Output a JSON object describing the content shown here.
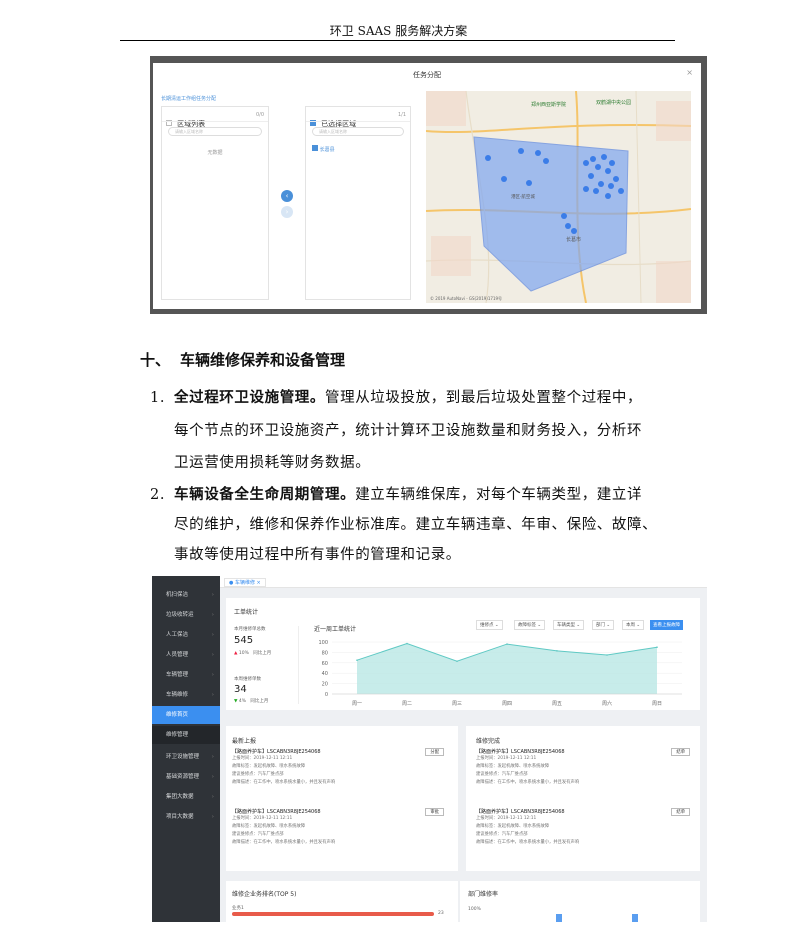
{
  "header": {
    "title": "环卫 SAAS 服务解决方案"
  },
  "modal": {
    "title": "任务分配",
    "close": "×",
    "breadcrumb": "长期清运工作组任务分配",
    "left_panel": {
      "title": "区域列表",
      "count": "0/0",
      "search_placeholder": "请输入区域名称",
      "empty": "无数据"
    },
    "right_panel": {
      "title": "已选择区域",
      "count": "1/1",
      "search_placeholder": "请输入区域名称",
      "item": "长葛县"
    },
    "map": {
      "labels": [
        "郑州西亚斯学院",
        "双鹤湖中央公园",
        "港区·航空城",
        "长葛市"
      ],
      "attribution": "© 2019 AutoNavi - GS(2019)1719号"
    }
  },
  "section10": {
    "number": "十、",
    "title": "车辆维修保养和设备管理",
    "items": [
      {
        "num": "1.",
        "bold": "全过程环卫设施管理。",
        "line1": "管理从垃圾投放，到最后垃圾处置整个过程中，",
        "line2": "每个节点的环卫设施资产，统计计算环卫设施数量和财务投入，分析环",
        "line3": "卫运营使用损耗等财务数据。"
      },
      {
        "num": "2.",
        "bold": "车辆设备全生命周期管理。",
        "line1": "建立车辆维保库，对每个车辆类型，建立详",
        "line2": "尽的维护，维修和保养作业标准库。建立车辆违章、年审、保险、故障、",
        "line3": "事故等使用过程中所有事件的管理和记录。"
      }
    ]
  },
  "dashboard": {
    "sidebar": [
      {
        "label": "机扫保洁"
      },
      {
        "label": "垃圾收转运"
      },
      {
        "label": "人工保洁"
      },
      {
        "label": "人员管理"
      },
      {
        "label": "车辆管理"
      },
      {
        "label": "车辆维修"
      },
      {
        "label": "维修首页"
      },
      {
        "label": "维修管理"
      },
      {
        "label": "环卫设施管理"
      },
      {
        "label": "基础资源管理"
      },
      {
        "label": "集团大数据"
      },
      {
        "label": "项目大数据"
      }
    ],
    "tab": "车辆维修",
    "work_stats": {
      "title": "工单统计",
      "month_label": "本月维修单总数",
      "month_value": "545",
      "month_change": "10%",
      "month_compare": "同比上月",
      "week_label": "本周维修单数",
      "week_value": "34",
      "week_change": "4%",
      "week_compare": "同比上月",
      "chart_title": "近一周工单统计",
      "filters": [
        "维修点",
        "故障标签",
        "车辆类型",
        "部门",
        "本周"
      ],
      "report_button": "查看上报故障"
    },
    "latest": {
      "title": "最新上报",
      "records": [
        {
          "title": "【路面养护车】LSCABN3R8JE254068",
          "button": "分配",
          "time": "上报时间：2019-12-11  12:11",
          "tags": "故障标签：发起机故障、喷水系统故障",
          "site": "建议维修点：汽车厂维点部",
          "desc": "故障描述：在工作中，喷水系统水量小，并且发有声响"
        },
        {
          "title": "【路面养护车】LSCABN3R8JE254068",
          "button": "审批",
          "time": "上报时间：2019-12-11  12:11",
          "tags": "故障标签：发起机故障、喷水系统故障",
          "site": "建议维修点：汽车厂维点部",
          "desc": "故障描述：在工作中，喷水系统水量小，并且发有声响"
        }
      ]
    },
    "done": {
      "title": "维修完成",
      "records": [
        {
          "title": "【路面养护车】LSCABN3R8JE254068",
          "button": "结单",
          "time": "上报时间：2019-12-11  12:11",
          "tags": "故障标签：发起机故障、喷水系统故障",
          "site": "建议维修点：汽车厂维点部",
          "desc": "故障描述：在工作中，喷水系统水量小，并且发有声响"
        },
        {
          "title": "【路面养护车】LSCABN3R8JE254068",
          "button": "结单",
          "time": "上报时间：2019-12-11  12:11",
          "tags": "故障标签：发起机故障、喷水系统故障",
          "site": "建议维修点：汽车厂维点部",
          "desc": "故障描述：在工作中，喷水系统水量小，并且发有声响"
        }
      ]
    },
    "ranking": {
      "title": "维修企业务排名(TOP 5)",
      "first_label": "业务1",
      "first_value": "23"
    },
    "rate": {
      "title": "部门维修率",
      "y_label": "100%"
    }
  },
  "chart_data": {
    "type": "area",
    "title": "近一周工单统计",
    "categories": [
      "周一",
      "周二",
      "周三",
      "周四",
      "周五",
      "周六",
      "周日"
    ],
    "values": [
      65,
      97,
      63,
      96,
      83,
      75,
      90
    ],
    "ylim": [
      0,
      100
    ],
    "yticks": [
      0,
      20,
      40,
      60,
      80,
      100
    ],
    "colors": {
      "line": "#5fc9c4",
      "fill": "#b9e7e5"
    }
  }
}
